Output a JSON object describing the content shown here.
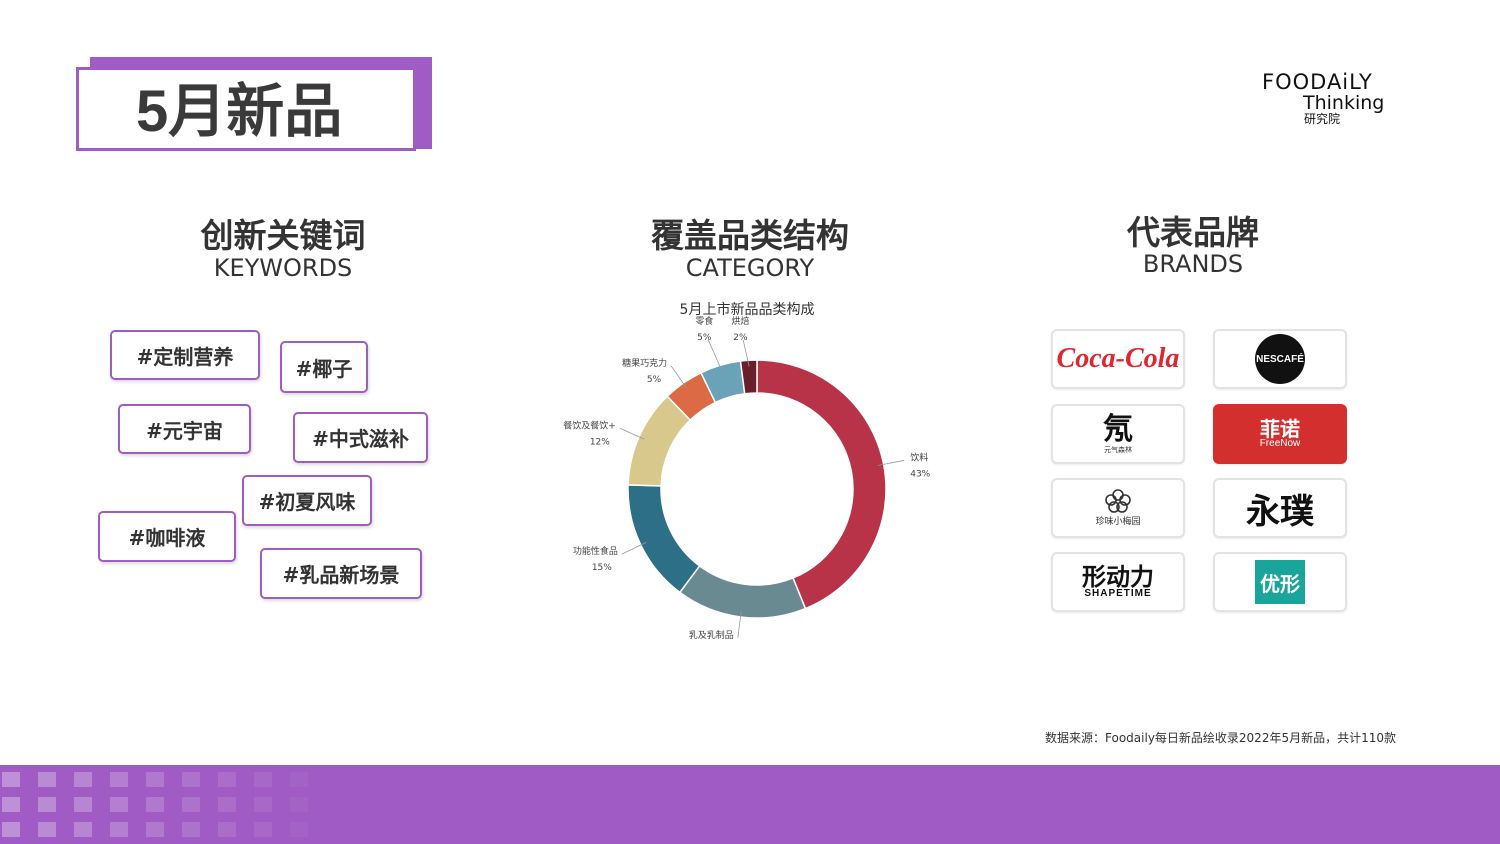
{
  "page": {
    "title": "5月新品",
    "logo": {
      "line1": "FOODAiLY",
      "line2": "Thinking",
      "line3": "研究院"
    },
    "source": "数据来源：Foodaily每日新品绘收录2022年5月新品，共计110款"
  },
  "keywords": {
    "title": "创新关键词",
    "subtitle": "KEYWORDS",
    "items": [
      "#定制营养",
      "#椰子",
      "#元宇宙",
      "#中式滋补",
      "#初夏风味",
      "#咖啡液",
      "#乳品新场景"
    ]
  },
  "category": {
    "title": "覆盖品类结构",
    "subtitle": "CATEGORY"
  },
  "chart_data": {
    "type": "pie",
    "title": "5月上市新品品类构成",
    "slices": [
      {
        "label": "饮料",
        "value": 43,
        "label_text": "43%",
        "color": "#b83248"
      },
      {
        "label": "乳及乳制品",
        "value": 16,
        "label_text": "16%",
        "color": "#6a8a92"
      },
      {
        "label": "功能性食品",
        "value": 15,
        "label_text": "15%",
        "color": "#2d6f87"
      },
      {
        "label": "餐饮及餐饮+",
        "value": 12,
        "label_text": "12%",
        "color": "#d8c88c"
      },
      {
        "label": "糖果巧克力",
        "value": 5,
        "label_text": "5%",
        "color": "#dc6a45"
      },
      {
        "label": "零食",
        "value": 5,
        "label_text": "5%",
        "color": "#6aa2b8"
      },
      {
        "label": "烘焙",
        "value": 2,
        "label_text": "2%",
        "color": "#6a1e2c"
      }
    ]
  },
  "brands": {
    "title": "代表品牌",
    "subtitle": "BRANDS",
    "items": [
      {
        "name": "Coca-Cola",
        "color": "#e0262f"
      },
      {
        "name": "NESCAFÉ",
        "color": "#111111"
      },
      {
        "name": "氖",
        "sub": "元气森林",
        "color": "#111111"
      },
      {
        "name": "菲诺",
        "sub": "FreeNow",
        "color": "#d32f2f"
      },
      {
        "name": "珍味小梅园",
        "color": "#333333"
      },
      {
        "name": "永璞",
        "color": "#111111"
      },
      {
        "name": "形动力",
        "sub": "SHAPETIME",
        "color": "#111111"
      },
      {
        "name": "优形",
        "color": "#1aa59a"
      }
    ]
  },
  "colors": {
    "accent": "#a05cc4"
  }
}
